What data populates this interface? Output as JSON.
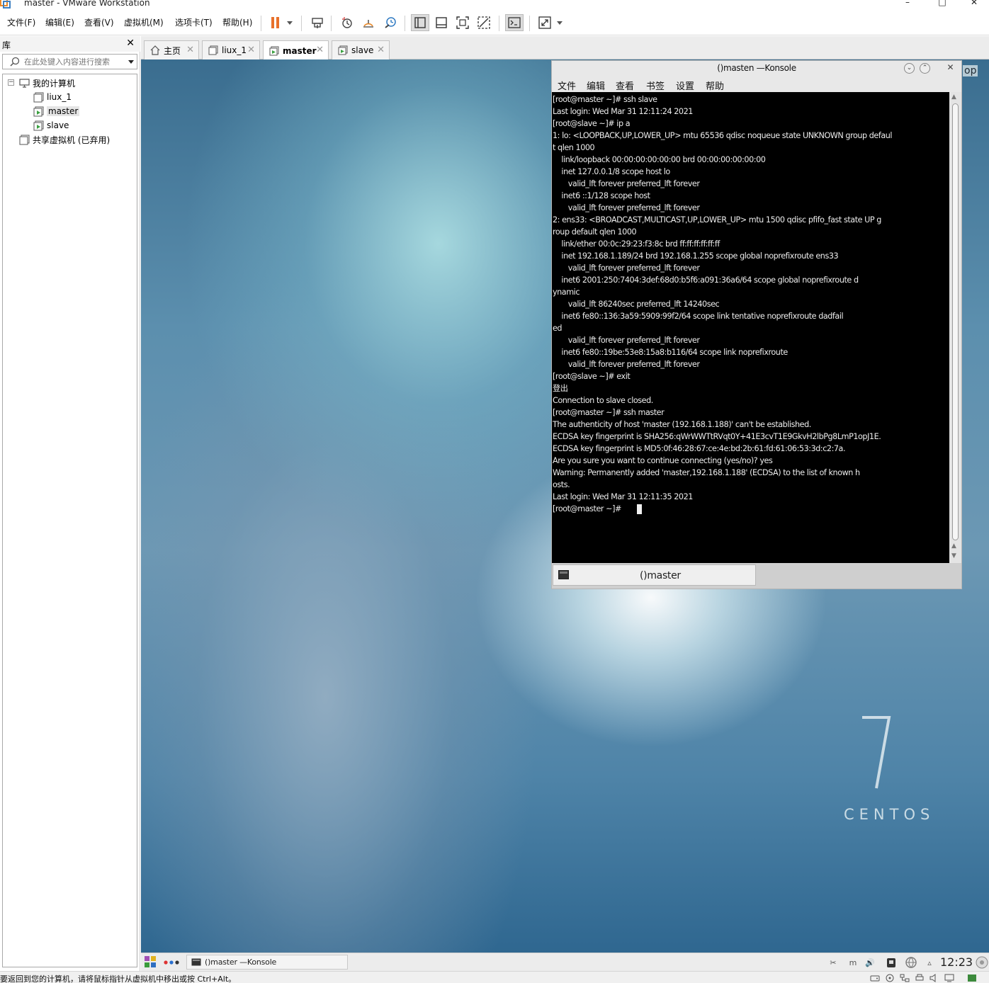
{
  "window": {
    "title": "master - VMware Workstation",
    "min_glyph": "–",
    "max_glyph": "□",
    "close_glyph": "✕"
  },
  "menu": [
    {
      "label": "文件(F)"
    },
    {
      "label": "编辑(E)"
    },
    {
      "label": "查看(V)"
    },
    {
      "label": "虚拟机(M)"
    },
    {
      "label": "选项卡(T)"
    },
    {
      "label": "帮助(H)"
    }
  ],
  "toolbar": {
    "icons": [
      "pause-icon",
      "send-ctrl-alt-del-icon",
      "snapshot-icon",
      "revert-snapshot-icon",
      "snapshot-manager-icon",
      "show-library-icon",
      "show-thumbnail-icon",
      "fullscreen-icon",
      "unity-icon",
      "console-view-icon",
      "stretch-icon"
    ]
  },
  "library": {
    "title": "库",
    "close_glyph": "✕",
    "search_placeholder": "在此处键入内容进行搜索",
    "tree": [
      {
        "label": "我的计算机",
        "level": 0,
        "icon": "computer-icon"
      },
      {
        "label": "liux_1",
        "level": 1,
        "icon": "vm-icon"
      },
      {
        "label": "master",
        "level": 1,
        "icon": "vm-running-icon",
        "selected": true
      },
      {
        "label": "slave",
        "level": 1,
        "icon": "vm-running-icon"
      },
      {
        "label": "共享虚拟机 (已弃用)",
        "level": 0,
        "icon": "shared-vm-icon"
      }
    ]
  },
  "tabs": [
    {
      "label": "主页",
      "icon": "home-icon"
    },
    {
      "label": "liux_1",
      "icon": "vm-icon"
    },
    {
      "label": "master",
      "icon": "vm-running-icon",
      "active": true
    },
    {
      "label": "slave",
      "icon": "vm-running-icon"
    }
  ],
  "guest": {
    "desktop_label_fragment": "op",
    "brand_numeral": "7",
    "brand_word": "CENTOS",
    "konsole": {
      "title": "()masten —Konsole",
      "menu": [
        "文件",
        "编辑",
        "查看",
        "书签",
        "设置",
        "帮助"
      ],
      "lines": [
        "[root@master ~]# ssh slave",
        "Last login: Wed Mar 31 12:11:24 2021",
        "[root@slave ~]# ip a",
        "1: lo: <LOOPBACK,UP,LOWER_UP> mtu 65536 qdisc noqueue state UNKNOWN group defaul",
        "t qlen 1000",
        "    link/loopback 00:00:00:00:00:00 brd 00:00:00:00:00:00",
        "    inet 127.0.0.1/8 scope host lo",
        "       valid_lft forever preferred_lft forever",
        "    inet6 ::1/128 scope host",
        "       valid_lft forever preferred_lft forever",
        "2: ens33: <BROADCAST,MULTICAST,UP,LOWER_UP> mtu 1500 qdisc pfifo_fast state UP g",
        "roup default qlen 1000",
        "    link/ether 00:0c:29:23:f3:8c brd ff:ff:ff:ff:ff:ff",
        "    inet 192.168.1.189/24 brd 192.168.1.255 scope global noprefixroute ens33",
        "       valid_lft forever preferred_lft forever",
        "    inet6 2001:250:7404:3def:68d0:b5f6:a091:36a6/64 scope global noprefixroute d",
        "ynamic",
        "       valid_lft 86240sec preferred_lft 14240sec",
        "    inet6 fe80::136:3a59:5909:99f2/64 scope link tentative noprefixroute dadfail",
        "ed",
        "       valid_lft forever preferred_lft forever",
        "    inet6 fe80::19be:53e8:15a8:b116/64 scope link noprefixroute",
        "       valid_lft forever preferred_lft forever",
        "[root@slave ~]# exit",
        "登出",
        "Connection to slave closed.",
        "[root@master ~]# ssh master",
        "The authenticity of host 'master (192.168.1.188)' can't be established.",
        "ECDSA key fingerprint is SHA256:qWrWWTtRVqt0Y+41E3cvT1E9GkvH2lbPg8LmP1opJ1E.",
        "ECDSA key fingerprint is MD5:0f:46:28:67:ce:4e:bd:2b:61:fd:61:06:53:3d:c2:7a.",
        "Are you sure you want to continue connecting (yes/no)? yes",
        "Warning: Permanently added 'master,192.168.1.188' (ECDSA) to the list of known h",
        "osts.",
        "Last login: Wed Mar 31 12:11:35 2021",
        "[root@master ~]# "
      ],
      "tab_label": "()master"
    },
    "taskbar": {
      "task_label": "()master —Konsole",
      "tray_text": "m",
      "clock": "12:23"
    }
  },
  "statusbar": {
    "message": "要返回到您的计算机，请将鼠标指针从虚拟机中移出或按 Ctrl+Alt。"
  },
  "colors": {
    "pause_accent": "#e8702a",
    "terminal_bg": "#000000",
    "terminal_fg": "#ededed"
  }
}
